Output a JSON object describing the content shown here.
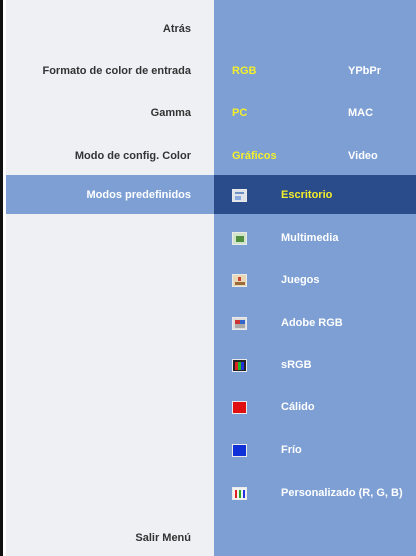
{
  "menu": {
    "back": "Atrás",
    "input_color_format": {
      "label": "Formato de color de entrada",
      "options": [
        "RGB",
        "YPbPr"
      ],
      "selected": "RGB"
    },
    "gamma": {
      "label": "Gamma",
      "options": [
        "PC",
        "MAC"
      ],
      "selected": "PC"
    },
    "color_mode": {
      "label": "Modo de config. Color",
      "options": [
        "Gráficos",
        "Video"
      ],
      "selected": "Gráficos"
    },
    "preset_modes": {
      "label": "Modos predefinidos"
    },
    "exit": "Salir Menú"
  },
  "presets": [
    {
      "label": "Escritorio",
      "icon": "desktop-icon",
      "selected": true
    },
    {
      "label": "Multimedia",
      "icon": "multimedia-icon",
      "selected": false
    },
    {
      "label": "Juegos",
      "icon": "games-icon",
      "selected": false
    },
    {
      "label": "Adobe RGB",
      "icon": "adobe-rgb-icon",
      "selected": false
    },
    {
      "label": "sRGB",
      "icon": "srgb-icon",
      "selected": false
    },
    {
      "label": "Cálido",
      "icon": "warm-icon",
      "selected": false
    },
    {
      "label": "Frío",
      "icon": "cool-icon",
      "selected": false
    },
    {
      "label": "Personalizado (R, G, B)",
      "icon": "custom-rgb-icon",
      "selected": false
    }
  ],
  "colors": {
    "panel_blue": "#7d9fd4",
    "selected_row": "#2b4c8a",
    "selected_text": "#f3ef2a",
    "left_bg": "#eef0f4"
  }
}
